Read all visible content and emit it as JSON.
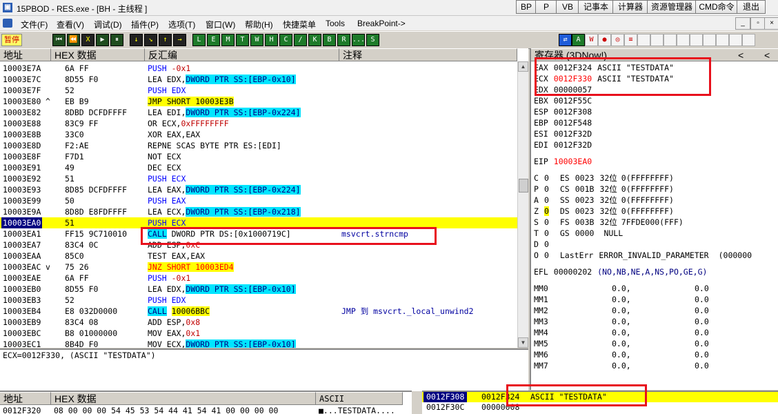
{
  "titlebar": {
    "title": "15PBOD  - RES.exe - [BH - 主线程 ]",
    "quick_buttons": [
      "BP",
      "P",
      "VB",
      "记事本",
      "计算器",
      "资源管理器",
      "CMD命令",
      "退出"
    ]
  },
  "menubar": {
    "items": [
      "文件(F)",
      "查看(V)",
      "调试(D)",
      "插件(P)",
      "选项(T)",
      "窗口(W)",
      "帮助(H)",
      "快捷菜单",
      "Tools",
      "BreakPoint->"
    ],
    "window_controls": [
      "_",
      "▫",
      "×"
    ]
  },
  "toolbar": {
    "status": "暂停",
    "tools": [
      "⏮",
      "⏪",
      "X",
      "▶",
      "⏸",
      "↓",
      "↘",
      "↑",
      "→",
      "L",
      "E",
      "M",
      "T",
      "W",
      "H",
      "C",
      "/",
      "K",
      "B",
      "R",
      "...",
      "S"
    ],
    "right_tools": [
      "⇄",
      "A",
      "W",
      "●",
      "◎",
      "≡"
    ]
  },
  "disasm": {
    "headers": [
      "地址",
      "HEX 数据",
      "反汇编",
      "注释"
    ],
    "rows": [
      {
        "addr": "10003E7A",
        "hex": "6A FF",
        "asm": [
          {
            "t": "PUSH ",
            "c": "blue"
          },
          {
            "t": "-0x1",
            "c": "olive"
          }
        ],
        "cmt": ""
      },
      {
        "addr": "10003E7C",
        "hex": "8D55 F0",
        "asm": [
          {
            "t": "LEA EDX,"
          },
          {
            "t": "DWORD PTR SS:[EBP-0x10]",
            "c": "cyan"
          }
        ],
        "cmt": ""
      },
      {
        "addr": "10003E7F",
        "hex": "52",
        "asm": [
          {
            "t": "PUSH EDX",
            "c": "blue"
          }
        ],
        "cmt": ""
      },
      {
        "addr": "10003E80",
        "mark": "^",
        "hex": "EB B9",
        "asm": [
          {
            "t": "JMP SHORT 10003E3B",
            "c": "yellow"
          }
        ],
        "cmt": ""
      },
      {
        "addr": "10003E82",
        "hex": "8DBD DCFDFFFF",
        "asm": [
          {
            "t": "LEA EDI,"
          },
          {
            "t": "DWORD PTR SS:[EBP-0x224]",
            "c": "cyan"
          }
        ],
        "cmt": ""
      },
      {
        "addr": "10003E88",
        "hex": "83C9 FF",
        "asm": [
          {
            "t": "OR ECX,"
          },
          {
            "t": "0xFFFFFFFF",
            "c": "olive"
          }
        ],
        "cmt": ""
      },
      {
        "addr": "10003E8B",
        "hex": "33C0",
        "asm": [
          {
            "t": "XOR EAX,EAX"
          }
        ],
        "cmt": ""
      },
      {
        "addr": "10003E8D",
        "hex": "F2:AE",
        "asm": [
          {
            "t": "REPNE SCAS BYTE PTR ES:[EDI]"
          }
        ],
        "cmt": ""
      },
      {
        "addr": "10003E8F",
        "hex": "F7D1",
        "asm": [
          {
            "t": "NOT ECX"
          }
        ],
        "cmt": ""
      },
      {
        "addr": "10003E91",
        "hex": "49",
        "asm": [
          {
            "t": "DEC ECX"
          }
        ],
        "cmt": ""
      },
      {
        "addr": "10003E92",
        "hex": "51",
        "asm": [
          {
            "t": "PUSH ECX",
            "c": "blue"
          }
        ],
        "cmt": ""
      },
      {
        "addr": "10003E93",
        "hex": "8D85 DCFDFFFF",
        "asm": [
          {
            "t": "LEA EAX,"
          },
          {
            "t": "DWORD PTR SS:[EBP-0x224]",
            "c": "cyan"
          }
        ],
        "cmt": ""
      },
      {
        "addr": "10003E99",
        "hex": "50",
        "asm": [
          {
            "t": "PUSH EAX",
            "c": "blue"
          }
        ],
        "cmt": ""
      },
      {
        "addr": "10003E9A",
        "hex": "8D8D E8FDFFFF",
        "asm": [
          {
            "t": "LEA ECX,"
          },
          {
            "t": "DWORD PTR SS:[EBP-0x218]",
            "c": "cyan"
          }
        ],
        "cmt": ""
      },
      {
        "addr": "10003EA0",
        "hex": "51",
        "asm": [
          {
            "t": "PUSH ECX",
            "c": "blue"
          }
        ],
        "cmt": "",
        "sel": true
      },
      {
        "addr": "10003EA1",
        "hex": "FF15 9C710010",
        "asm": [
          {
            "t": "CALL",
            "c": "cyan"
          },
          {
            "t": " DWORD PTR DS:[0x1000719C]"
          }
        ],
        "cmt": "msvcrt.strncmp"
      },
      {
        "addr": "10003EA7",
        "hex": "83C4 0C",
        "asm": [
          {
            "t": "ADD ESP,"
          },
          {
            "t": "0xC",
            "c": "olive"
          }
        ],
        "cmt": ""
      },
      {
        "addr": "10003EAA",
        "hex": "85C0",
        "asm": [
          {
            "t": "TEST EAX,EAX"
          }
        ],
        "cmt": ""
      },
      {
        "addr": "10003EAC",
        "mark": "v",
        "hex": "75 26",
        "asm": [
          {
            "t": "JNZ SHORT 10003ED4",
            "c": "yellowred"
          }
        ],
        "cmt": ""
      },
      {
        "addr": "10003EAE",
        "hex": "6A FF",
        "asm": [
          {
            "t": "PUSH ",
            "c": "blue"
          },
          {
            "t": "-0x1",
            "c": "olive"
          }
        ],
        "cmt": ""
      },
      {
        "addr": "10003EB0",
        "hex": "8D55 F0",
        "asm": [
          {
            "t": "LEA EDX,"
          },
          {
            "t": "DWORD PTR SS:[EBP-0x10]",
            "c": "cyan"
          }
        ],
        "cmt": ""
      },
      {
        "addr": "10003EB3",
        "hex": "52",
        "asm": [
          {
            "t": "PUSH EDX",
            "c": "blue"
          }
        ],
        "cmt": ""
      },
      {
        "addr": "10003EB4",
        "hex": "E8 032D0000",
        "asm": [
          {
            "t": "CALL",
            "c": "cyan"
          },
          {
            "t": " "
          },
          {
            "t": "10006BBC",
            "c": "yellow"
          }
        ],
        "cmt": "JMP 到 msvcrt._local_unwind2"
      },
      {
        "addr": "10003EB9",
        "hex": "83C4 08",
        "asm": [
          {
            "t": "ADD ESP,"
          },
          {
            "t": "0x8",
            "c": "olive"
          }
        ],
        "cmt": ""
      },
      {
        "addr": "10003EBC",
        "hex": "B8 01000000",
        "asm": [
          {
            "t": "MOV EAX,"
          },
          {
            "t": "0x1",
            "c": "olive"
          }
        ],
        "cmt": ""
      },
      {
        "addr": "10003EC1",
        "hex": "8B4D F0",
        "asm": [
          {
            "t": "MOV ECX,"
          },
          {
            "t": "DWORD PTR SS:[EBP-0x10]",
            "c": "cyan"
          }
        ],
        "cmt": ""
      }
    ],
    "info": "ECX=0012F330, (ASCII \"TESTDATA\")"
  },
  "registers": {
    "title": "寄存器 (3DNow!)",
    "gp": [
      {
        "name": "EAX",
        "val": "0012F324",
        "note": "ASCII \"TESTDATA\""
      },
      {
        "name": "ECX",
        "val": "0012F330",
        "note": "ASCII \"TESTDATA\"",
        "changed": true
      },
      {
        "name": "EDX",
        "val": "00000057",
        "note": ""
      },
      {
        "name": "EBX",
        "val": "0012F55C",
        "note": ""
      },
      {
        "name": "ESP",
        "val": "0012F308",
        "note": ""
      },
      {
        "name": "EBP",
        "val": "0012F548",
        "note": ""
      },
      {
        "name": "ESI",
        "val": "0012F32D",
        "note": ""
      },
      {
        "name": "EDI",
        "val": "0012F32D",
        "note": ""
      }
    ],
    "eip": {
      "name": "EIP",
      "val": "10003EA0"
    },
    "flags": [
      {
        "f": "C",
        "v": "0",
        "seg": "ES",
        "sv": "0023",
        "bits": "32位",
        "rest": "0(FFFFFFFF)"
      },
      {
        "f": "P",
        "v": "0",
        "seg": "CS",
        "sv": "001B",
        "bits": "32位",
        "rest": "0(FFFFFFFF)"
      },
      {
        "f": "A",
        "v": "0",
        "seg": "SS",
        "sv": "0023",
        "bits": "32位",
        "rest": "0(FFFFFFFF)"
      },
      {
        "f": "Z",
        "v": "0",
        "seg": "DS",
        "sv": "0023",
        "bits": "32位",
        "rest": "0(FFFFFFFF)",
        "hl": true
      },
      {
        "f": "S",
        "v": "0",
        "seg": "FS",
        "sv": "003B",
        "bits": "32位",
        "rest": "7FFDE000(FFF)"
      },
      {
        "f": "T",
        "v": "0",
        "seg": "GS",
        "sv": "0000",
        "bits": "",
        "rest": "NULL"
      },
      {
        "f": "D",
        "v": "0",
        "seg": "",
        "sv": "",
        "bits": "",
        "rest": ""
      },
      {
        "f": "O",
        "v": "0",
        "seg": "LastErr",
        "sv": "ERROR_INVALID_PARAMETER",
        "bits": "",
        "rest": "(000000"
      }
    ],
    "efl": {
      "name": "EFL",
      "val": "00000202",
      "note": "(NO,NB,NE,A,NS,PO,GE,G)"
    },
    "mmx": [
      {
        "name": "MM0",
        "a": "0.0,",
        "b": "0.0"
      },
      {
        "name": "MM1",
        "a": "0.0,",
        "b": "0.0"
      },
      {
        "name": "MM2",
        "a": "0.0,",
        "b": "0.0"
      },
      {
        "name": "MM3",
        "a": "0.0,",
        "b": "0.0"
      },
      {
        "name": "MM4",
        "a": "0.0,",
        "b": "0.0"
      },
      {
        "name": "MM5",
        "a": "0.0,",
        "b": "0.0"
      },
      {
        "name": "MM6",
        "a": "0.0,",
        "b": "0.0"
      },
      {
        "name": "MM7",
        "a": "0.0,",
        "b": "0.0"
      }
    ],
    "nav": [
      "<",
      "<"
    ]
  },
  "dump": {
    "headers": [
      "地址",
      "HEX 数据",
      "ASCII"
    ],
    "row": {
      "addr": "0012F320",
      "hex": "08 00 00 00 54 45 53 54 44 41 54 41 00 00 00 00",
      "ascii": "■...TESTDATA...."
    }
  },
  "stack": {
    "rows": [
      {
        "addr": "0012F308",
        "val": "0012F324",
        "cmt": "ASCII \"TESTDATA\"",
        "sel": true
      },
      {
        "addr": "0012F30C",
        "val": "00000008",
        "cmt": ""
      }
    ]
  },
  "colors": {
    "highlight_cyan": "#00e5ff",
    "highlight_yellow": "#ffff00",
    "annotation_red": "#e8101c",
    "changed_red": "#ff0000"
  }
}
